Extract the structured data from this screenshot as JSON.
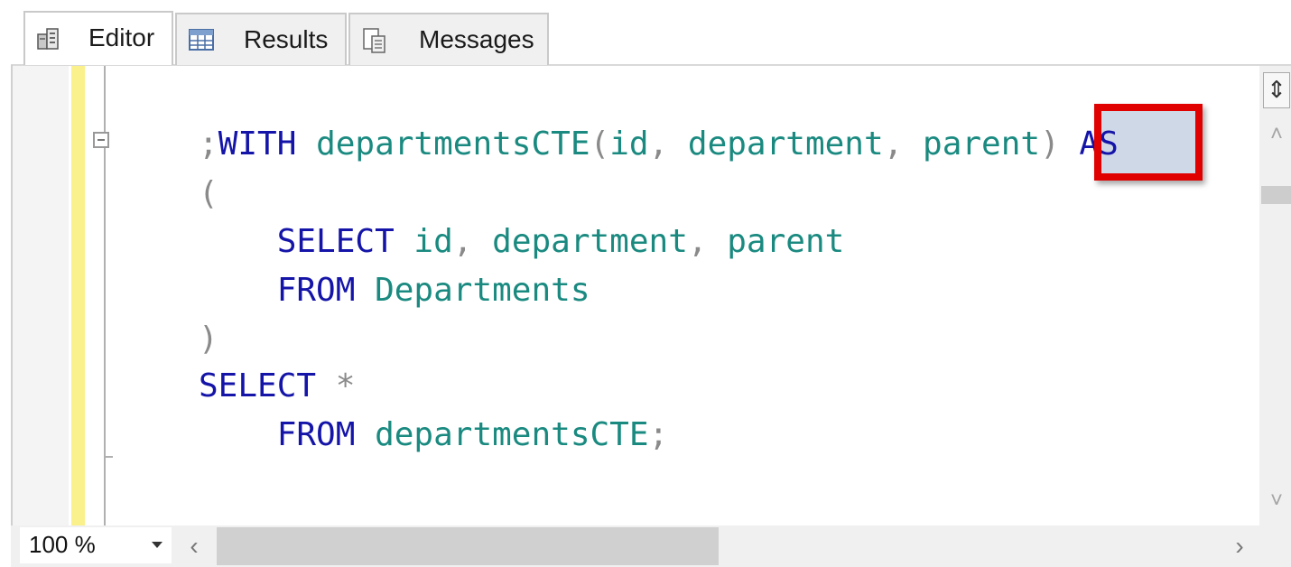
{
  "tabs": [
    {
      "label": "Editor",
      "icon": "query-editor-icon",
      "active": true
    },
    {
      "label": "Results",
      "icon": "grid-icon",
      "active": false
    },
    {
      "label": "Messages",
      "icon": "messages-icon",
      "active": false
    }
  ],
  "code": {
    "lines": [
      [
        [
          ";",
          "op"
        ],
        [
          "WITH",
          "kw"
        ],
        [
          " departmentsCTE",
          "id"
        ],
        [
          "(",
          "op"
        ],
        [
          "id",
          "id"
        ],
        [
          ", ",
          "op"
        ],
        [
          "department",
          "id"
        ],
        [
          ", ",
          "op"
        ],
        [
          "parent",
          "id"
        ],
        [
          ") ",
          "op"
        ],
        [
          "AS",
          "kw"
        ]
      ],
      [
        [
          "(",
          "op"
        ]
      ],
      [
        [
          "    ",
          "op"
        ],
        [
          "SELECT",
          "kw"
        ],
        [
          " id",
          "id"
        ],
        [
          ", ",
          "op"
        ],
        [
          "department",
          "id"
        ],
        [
          ", ",
          "op"
        ],
        [
          "parent",
          "id"
        ]
      ],
      [
        [
          "    ",
          "op"
        ],
        [
          "FROM",
          "kw"
        ],
        [
          " Departments",
          "id"
        ]
      ],
      [
        [
          ")",
          "op"
        ]
      ],
      [
        [
          "SELECT",
          "kw"
        ],
        [
          " *",
          "op"
        ]
      ],
      [
        [
          "    ",
          "op"
        ],
        [
          "FROM",
          "kw"
        ],
        [
          " departmentsCTE",
          "id"
        ],
        [
          ";",
          "op"
        ]
      ]
    ],
    "highlighted_keyword": "AS"
  },
  "statusbar": {
    "zoom": "100 %"
  },
  "scrollbars": {
    "horizontal_thumb_fraction": 0.5
  },
  "colors": {
    "keyword": "#1414a8",
    "identifier": "#1a8a80",
    "operator": "#8a8a8a",
    "highlight_border": "#e00000",
    "change_bar": "#fbf18c"
  }
}
